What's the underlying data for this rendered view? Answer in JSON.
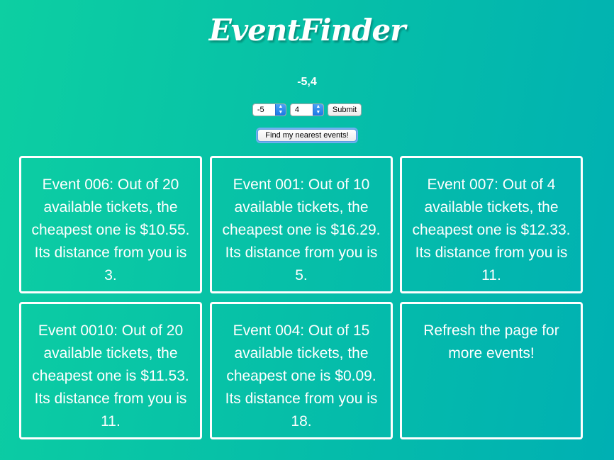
{
  "header": {
    "title": "EventFinder"
  },
  "location": {
    "coords_text": "-5,4",
    "x_value": "-5",
    "y_value": "4",
    "submit_label": "Submit",
    "find_label": "Find my nearest events!"
  },
  "events": [
    {
      "text": "Event 006: Out of 20 available tickets, the cheapest one is $10.55. Its distance from you is 3."
    },
    {
      "text": "Event 001: Out of 10 available tickets, the cheapest one is $16.29. Its distance from you is 5."
    },
    {
      "text": "Event 007: Out of 4 available tickets, the cheapest one is $12.33. Its distance from you is 11."
    },
    {
      "text": "Event 0010: Out of 20 available tickets, the cheapest one is $11.53. Its distance from you is 11."
    },
    {
      "text": "Event 004: Out of 15 available tickets, the cheapest one is $0.09. Its distance from you is 18."
    },
    {
      "text": "Refresh the page for more events!"
    }
  ],
  "icons": {
    "select_arrow": "chevron-up-down-icon"
  },
  "colors": {
    "background_start": "#0dcfa2",
    "background_end": "#00b0b3",
    "card_border": "#ffffff",
    "select_arrow": "#1a78e4"
  }
}
